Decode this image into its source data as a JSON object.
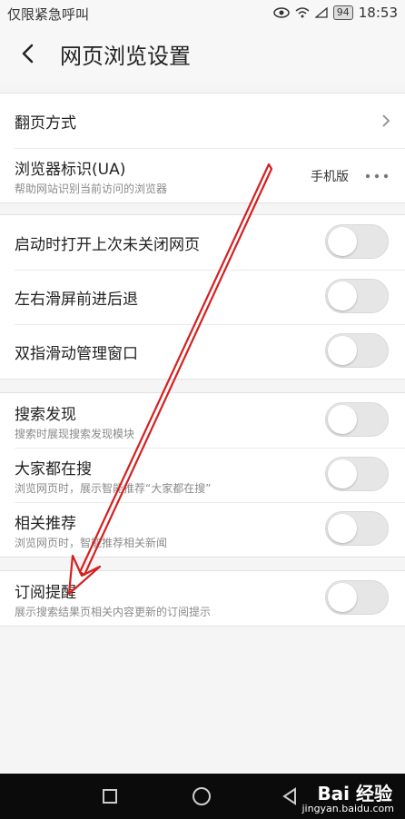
{
  "status_bar": {
    "carrier": "仅限紧急呼叫",
    "battery": "94",
    "time": "18:53"
  },
  "header": {
    "title": "网页浏览设置"
  },
  "groups": [
    {
      "rows": [
        {
          "label": "翻页方式",
          "type": "chevron"
        },
        {
          "label": "浏览器标识(UA)",
          "sub": "帮助网站识别当前访问的浏览器",
          "value": "手机版",
          "type": "more"
        }
      ]
    },
    {
      "rows": [
        {
          "label": "启动时打开上次未关闭网页",
          "toggle": false
        },
        {
          "label": "左右滑屏前进后退",
          "toggle": false
        },
        {
          "label": "双指滑动管理窗口",
          "toggle": false
        }
      ]
    },
    {
      "rows": [
        {
          "label": "搜索发现",
          "sub": "搜索时展现搜索发现模块",
          "toggle": false
        },
        {
          "label": "大家都在搜",
          "sub": "浏览网页时，展示智能推荐“大家都在搜”",
          "toggle": false
        },
        {
          "label": "相关推荐",
          "sub": "浏览网页时，智能推荐相关新闻",
          "toggle": false
        }
      ]
    },
    {
      "rows": [
        {
          "label": "订阅提醒",
          "sub": "展示搜索结果页相关内容更新的订阅提示",
          "toggle": false
        }
      ]
    }
  ],
  "watermark": {
    "logo": "Bai 经验",
    "url": "jingyan.baidu.com"
  },
  "colors": {
    "annotation_arrow": "#d42020",
    "toggle_off": "#e6e6e6"
  }
}
